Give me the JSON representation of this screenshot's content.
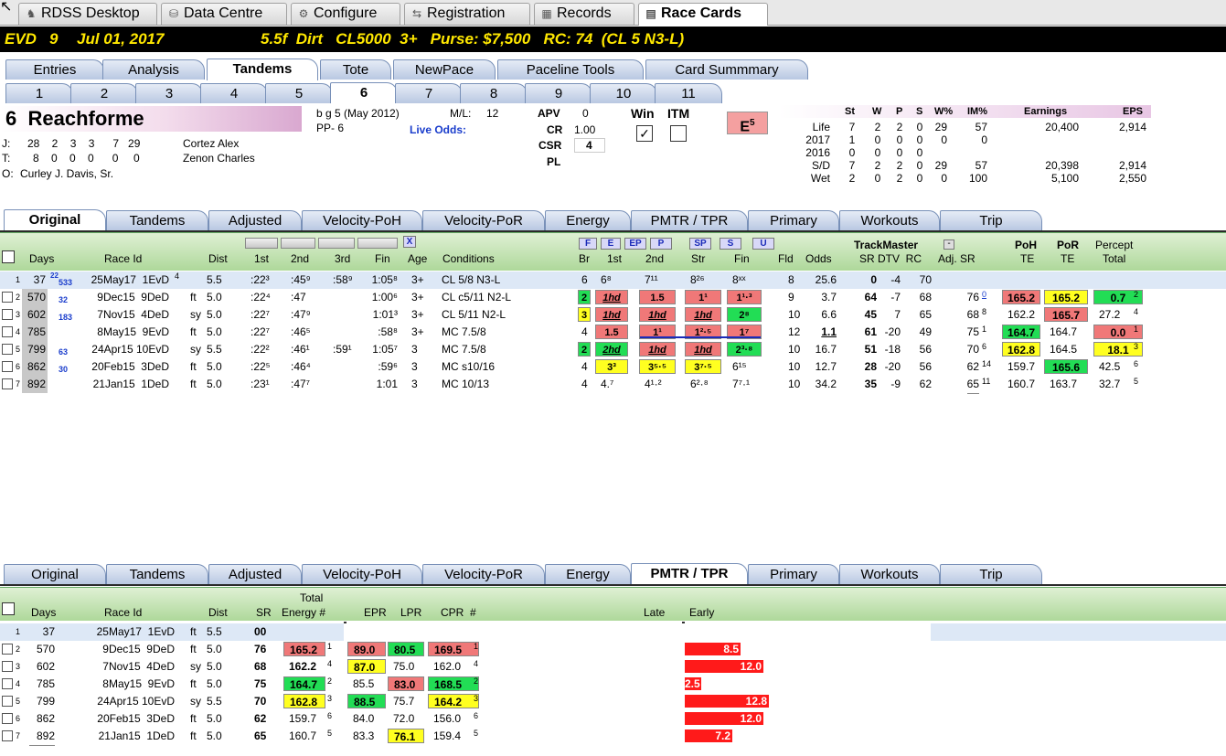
{
  "app_tabs": [
    {
      "label": "RDSS Desktop",
      "icon": "horse-icon"
    },
    {
      "label": "Data Centre",
      "icon": "database-icon"
    },
    {
      "label": "Configure",
      "icon": "gear-icon"
    },
    {
      "label": "Registration",
      "icon": "registration-icon"
    },
    {
      "label": "Records",
      "icon": "grid-icon"
    },
    {
      "label": "Race Cards",
      "icon": "card-icon"
    }
  ],
  "race_header": {
    "track": "EVD",
    "race": "9",
    "date": "Jul 01, 2017",
    "conditions": "5.5f  Dirt   CL5000  3+   Purse: $7,500   RC: 74  (CL 5 N3-L)"
  },
  "main_tabs": [
    "Entries",
    "Analysis",
    "Tandems",
    "Tote",
    "NewPace",
    "Paceline Tools",
    "Card Summmary"
  ],
  "race_tabs": [
    "1",
    "2",
    "3",
    "4",
    "5",
    "6",
    "7",
    "8",
    "9",
    "10",
    "11"
  ],
  "horse": {
    "number": "6",
    "name": "Reachforme",
    "breeding": "b g 5  (May 2012)",
    "pp": "PP- 6",
    "ml_label": "M/L:",
    "ml_value": "12",
    "live_odds": "Live Odds:",
    "jockey": {
      "prefix": "J:",
      "stats": "28    2    3    3      7   29",
      "name": "Cortez Alex"
    },
    "trainer": {
      "prefix": "T:",
      "stats": "8    0    0    0      0     0",
      "name": "Zenon Charles"
    },
    "owner": {
      "prefix": "O:",
      "name": "Curley J. Davis, Sr."
    },
    "apv_label": "APV",
    "apv": "0",
    "cr_label": "CR",
    "cr": "1.00",
    "csr_label": "CSR",
    "csr": "4",
    "pl_label": "PL",
    "win_label": "Win",
    "itm_label": "ITM",
    "energy_badge": "E",
    "energy_sup": "5"
  },
  "stats": {
    "headers": [
      "St",
      "W",
      "P",
      "S",
      "W%",
      "IM%",
      "Earnings",
      "EPS"
    ],
    "rows": [
      [
        "Life",
        "7",
        "2",
        "2",
        "0",
        "29",
        "57",
        "20,400",
        "2,914"
      ],
      [
        "2017",
        "1",
        "0",
        "0",
        "0",
        "0",
        "0",
        "",
        ""
      ],
      [
        "2016",
        "0",
        "0",
        "0",
        "0",
        "",
        "",
        "",
        ""
      ],
      [
        "S/D",
        "7",
        "2",
        "2",
        "0",
        "29",
        "57",
        "20,398",
        "2,914"
      ],
      [
        "Wet",
        "2",
        "0",
        "2",
        "0",
        "0",
        "100",
        "5,100",
        "2,550"
      ]
    ]
  },
  "sub_tabs": [
    "Original",
    "Tandems",
    "Adjusted",
    "Velocity-PoH",
    "Velocity-PoR",
    "Energy",
    "PMTR / TPR",
    "Primary",
    "Workouts",
    "Trip"
  ],
  "top_grid": {
    "headers": {
      "days": "Days",
      "raceid": "Race Id",
      "dist": "Dist",
      "first": "1st",
      "second": "2nd",
      "third": "3rd",
      "fin": "Fin",
      "age": "Age",
      "cond": "Conditions",
      "br": "Br",
      "c1st": "1st",
      "c2nd": "2nd",
      "str": "Str",
      "cfin": "Fin",
      "fld": "Fld",
      "odds": "Odds",
      "tm": "TrackMaster",
      "srdtv": "SR DTV  RC",
      "adjsr": "Adj. SR",
      "poh": "PoH",
      "poh2": "TE",
      "por": "PoR",
      "por2": "TE",
      "percept": "Percept",
      "percept2": "Total"
    },
    "buttons": [
      "F",
      "E",
      "EP",
      "P",
      "SP",
      "S",
      "U",
      "X"
    ],
    "rows": [
      {
        "n": "1",
        "days": "37",
        "d2": "22",
        "d3": "533",
        "race": "25May17  1EvD",
        "rsup": "4",
        "surf": "",
        "dist": "5.5",
        "f1": ":22³",
        "f2": ":45⁹",
        "f3": ":58⁹",
        "fin": "1:05⁸",
        "age": "3+",
        "cond": "CL 5/8 N3-L",
        "br": "6",
        "c1": "6⁸",
        "c2": "7¹¹",
        "cs": "8²⁶",
        "cf": "8ˣˣ",
        "fld": "8",
        "odds": "25.6",
        "sr": "0",
        "dtv": "-4",
        "rc": "70",
        "adj": "",
        "poh": "",
        "por": "",
        "pt": ""
      },
      {
        "n": "2",
        "days": "570",
        "d2": "",
        "d3": "32",
        "race": "9Dec15  9DeD",
        "rsup": "",
        "surf": "ft",
        "dist": "5.0",
        "f1": ":22⁴",
        "f2": ":47",
        "f3": "",
        "fin": "1:00⁶",
        "age": "3+",
        "cond": "CL c5/11 N2-L",
        "br": "2",
        "c1": "1hd",
        "c2": "1.5",
        "cs": "1¹",
        "cf": "1¹·³",
        "fld": "9",
        "odds": "3.7",
        "sr": "64",
        "dtv": "-7",
        "rc": "68",
        "adj": "76",
        "adjs": "0",
        "poh": "165.2",
        "por": "165.2",
        "pt": "0.7",
        "pts": "2"
      },
      {
        "n": "3",
        "days": "602",
        "d2": "",
        "d3": "183",
        "race": "7Nov15  4DeD",
        "rsup": "",
        "surf": "sy",
        "dist": "5.0",
        "f1": ":22⁷",
        "f2": ":47⁹",
        "f3": "",
        "fin": "1:01³",
        "age": "3+",
        "cond": "CL 5/11 N2-L",
        "br": "3",
        "c1": "1hd",
        "c2": "1hd",
        "cs": "1hd",
        "cf": "2⁸",
        "fld": "10",
        "odds": "6.6",
        "sr": "45",
        "dtv": "7",
        "rc": "65",
        "adj": "68",
        "adjs": "8",
        "poh": "162.2",
        "por": "165.7",
        "pt": "27.2",
        "pts": "4"
      },
      {
        "n": "4",
        "days": "785",
        "d2": "",
        "d3": "",
        "race": "8May15  9EvD",
        "rsup": "",
        "surf": "ft",
        "dist": "5.0",
        "f1": ":22⁷",
        "f2": ":46⁵",
        "f3": "",
        "fin": ":58⁸",
        "age": "3+",
        "cond": "MC 7.5/8",
        "br": "4",
        "c1": "1.5",
        "c2": "1¹",
        "cs": "1²·⁵",
        "cf": "1⁷",
        "fld": "12",
        "odds": "1.1",
        "sr": "61",
        "dtv": "-20",
        "rc": "49",
        "adj": "75",
        "adjs": "1",
        "poh": "164.7",
        "por": "164.7",
        "pt": "0.0",
        "pts": "1"
      },
      {
        "n": "5",
        "days": "799",
        "d2": "",
        "d3": "63",
        "race": "24Apr15 10EvD",
        "rsup": "",
        "surf": "sy",
        "dist": "5.5",
        "f1": ":22²",
        "f2": ":46¹",
        "f3": ":59¹",
        "fin": "1:05⁷",
        "age": "3",
        "cond": "MC 7.5/8",
        "br": "2",
        "c1": "2hd",
        "c2": "1hd",
        "cs": "1hd",
        "cf": "2³·⁸",
        "fld": "10",
        "odds": "16.7",
        "sr": "51",
        "dtv": "-18",
        "rc": "56",
        "adj": "70",
        "adjs": "6",
        "poh": "162.8",
        "por": "164.5",
        "pt": "18.1",
        "pts": "3"
      },
      {
        "n": "6",
        "days": "862",
        "d2": "",
        "d3": "30",
        "race": "20Feb15  3DeD",
        "rsup": "",
        "surf": "ft",
        "dist": "5.0",
        "f1": ":22⁵",
        "f2": ":46⁴",
        "f3": "",
        "fin": ":59⁶",
        "age": "3",
        "cond": "MC s10/16",
        "br": "4",
        "c1": "3³",
        "c2": "3⁵·⁵",
        "cs": "3⁷·⁵",
        "cf": "6¹⁵",
        "fld": "10",
        "odds": "12.7",
        "sr": "28",
        "dtv": "-20",
        "rc": "56",
        "adj": "62",
        "adjs": "14",
        "poh": "159.7",
        "por": "165.6",
        "pt": "42.5",
        "pts": "6"
      },
      {
        "n": "7",
        "days": "892",
        "d2": "",
        "d3": "",
        "race": "21Jan15  1DeD",
        "rsup": "",
        "surf": "ft",
        "dist": "5.0",
        "f1": ":23¹",
        "f2": ":47⁷",
        "f3": "",
        "fin": "1:01",
        "age": "3",
        "cond": "MC 10/13",
        "br": "4",
        "c1": "4.⁷",
        "c2": "4¹·²",
        "cs": "6²·⁸",
        "cf": "7⁷·¹",
        "fld": "10",
        "odds": "34.2",
        "sr": "35",
        "dtv": "-9",
        "rc": "62",
        "adj": "65",
        "adjs": "11",
        "poh": "160.7",
        "por": "163.7",
        "pt": "32.7",
        "pts": "5"
      }
    ]
  },
  "bottom_grid": {
    "headers": {
      "days": "Days",
      "raceid": "Race Id",
      "dist": "Dist",
      "sr": "SR",
      "te1": "Total",
      "te2": "Energy #",
      "epr": "EPR",
      "lpr": "LPR",
      "cpr": "CPR  #",
      "late": "Late",
      "early": "Early"
    },
    "rows": [
      {
        "n": "1",
        "days": "37",
        "race": "25May17  1EvD",
        "surf": "ft",
        "dist": "5.5",
        "sr": "00",
        "te": "",
        "tes": "",
        "epr": "",
        "lpr": "",
        "cpr": "",
        "cprs": "",
        "bar": ""
      },
      {
        "n": "2",
        "days": "570",
        "race": "9Dec15  9DeD",
        "surf": "ft",
        "dist": "5.0",
        "sr": "76",
        "te": "165.2",
        "tes": "1",
        "epr": "89.0",
        "lpr": "80.5",
        "cpr": "169.5",
        "cprs": "1",
        "bar": "8.5"
      },
      {
        "n": "3",
        "days": "602",
        "race": "7Nov15  4DeD",
        "surf": "sy",
        "dist": "5.0",
        "sr": "68",
        "te": "162.2",
        "tes": "4",
        "epr": "87.0",
        "lpr": "75.0",
        "cpr": "162.0",
        "cprs": "4",
        "bar": "12.0"
      },
      {
        "n": "4",
        "days": "785",
        "race": "8May15  9EvD",
        "surf": "ft",
        "dist": "5.0",
        "sr": "75",
        "te": "164.7",
        "tes": "2",
        "epr": "85.5",
        "lpr": "83.0",
        "cpr": "168.5",
        "cprs": "2",
        "bar": "2.5"
      },
      {
        "n": "5",
        "days": "799",
        "race": "24Apr15 10EvD",
        "surf": "sy",
        "dist": "5.5",
        "sr": "70",
        "te": "162.8",
        "tes": "3",
        "epr": "88.5",
        "lpr": "75.7",
        "cpr": "164.2",
        "cprs": "3",
        "bar": "12.8"
      },
      {
        "n": "6",
        "days": "862",
        "race": "20Feb15  3DeD",
        "surf": "ft",
        "dist": "5.0",
        "sr": "62",
        "te": "159.7",
        "tes": "6",
        "epr": "84.0",
        "lpr": "72.0",
        "cpr": "156.0",
        "cprs": "6",
        "bar": "12.0"
      },
      {
        "n": "7",
        "days": "892",
        "race": "21Jan15  1DeD",
        "surf": "ft",
        "dist": "5.0",
        "sr": "65",
        "te": "160.7",
        "tes": "5",
        "epr": "83.3",
        "lpr": "76.1",
        "cpr": "159.4",
        "cprs": "5",
        "bar": "7.2"
      }
    ]
  },
  "colors": {
    "accent_yellow": "#ffe800",
    "red": "#f07878",
    "yellow": "#ffff20",
    "green": "#22dd55",
    "bar_red": "#ff1a1a"
  }
}
